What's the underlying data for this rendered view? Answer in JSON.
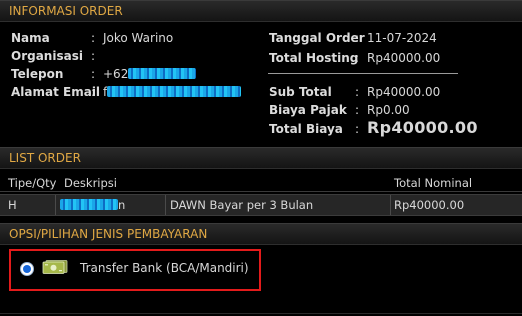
{
  "info": {
    "title": "INFORMASI ORDER",
    "left": [
      {
        "key": "Nama",
        "colon": ":",
        "value": "Joko Warino"
      },
      {
        "key": "Organisasi",
        "colon": ":",
        "value": ""
      },
      {
        "key": "Telepon",
        "colon": ":",
        "value": "+62"
      },
      {
        "key": "Alamat Email",
        "colon": ":",
        "value": "f"
      }
    ],
    "right_top": [
      {
        "key": "Tanggal Order",
        "colon": ":",
        "value": "11-07-2024"
      },
      {
        "key": "Total Hosting",
        "colon": ":",
        "value": "Rp40000.00"
      }
    ],
    "right_bottom": [
      {
        "key": "Sub Total",
        "colon": ":",
        "value": "Rp40000.00"
      },
      {
        "key": "Biaya Pajak",
        "colon": ":",
        "value": "Rp0.00"
      },
      {
        "key": "Total Biaya",
        "colon": ":",
        "value": "Rp40000.00"
      }
    ]
  },
  "list": {
    "title": "LIST ORDER",
    "headers": {
      "type": "Tipe/Qty",
      "desc": "Deskripsi",
      "total": "Total Nominal"
    },
    "rows": [
      {
        "type": "H",
        "desc_suffix": "n",
        "plan": "DAWN Bayar per 3 Bulan",
        "total": "Rp40000.00"
      }
    ]
  },
  "payment": {
    "title": "OPSI/PILIHAN JENIS PEMBAYARAN",
    "option_label": "Transfer Bank (BCA/Mandiri)",
    "icon": "money-icon",
    "selected": true
  },
  "colors": {
    "header_text": "#e0a844",
    "total_red": "#ff2020",
    "highlight_box": "#e41b1b",
    "redaction": "#1aa7e8"
  }
}
